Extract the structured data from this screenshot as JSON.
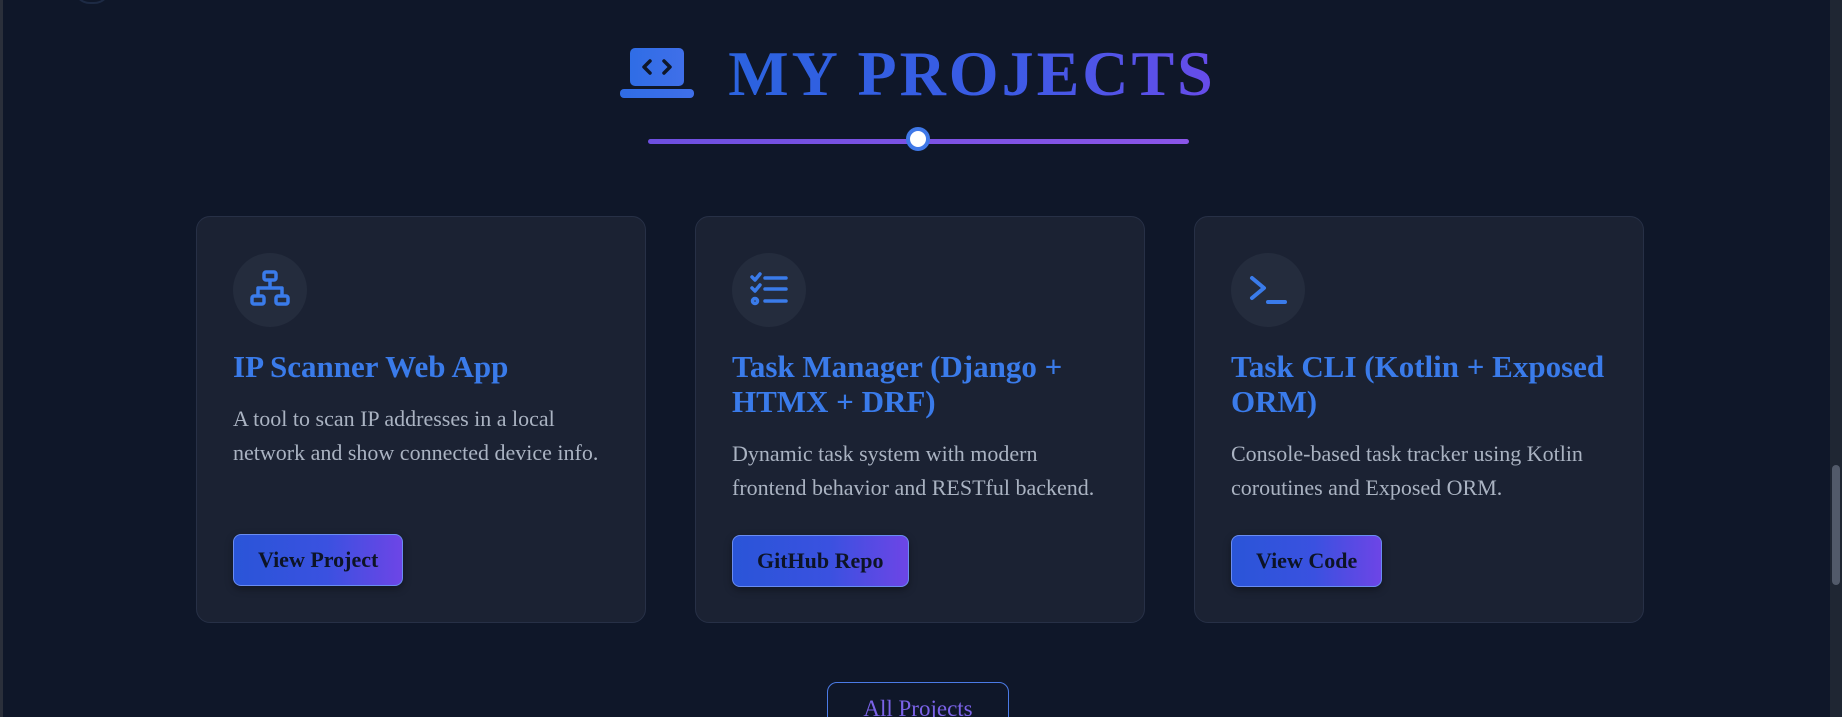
{
  "section": {
    "title": "MY PROJECTS",
    "title_icon": "laptop-code-icon"
  },
  "projects": [
    {
      "icon": "network-icon",
      "title": "IP Scanner Web App",
      "description": "A tool to scan IP addresses in a local network and show connected device info.",
      "button_label": "View Project"
    },
    {
      "icon": "task-list-icon",
      "title": "Task Manager (Django + HTMX + DRF)",
      "description": "Dynamic task system with modern frontend behavior and RESTful backend.",
      "button_label": "GitHub Repo"
    },
    {
      "icon": "terminal-icon",
      "title": "Task CLI (Kotlin + Exposed ORM)",
      "description": "Console-based task tracker using Kotlin coroutines and Exposed ORM.",
      "button_label": "View Code"
    }
  ],
  "all_projects_label": "All Projects",
  "colors": {
    "background": "#0f1729",
    "card": "#1b2233",
    "accent_blue": "#3a7bea",
    "accent_purple": "#6d45e6"
  }
}
